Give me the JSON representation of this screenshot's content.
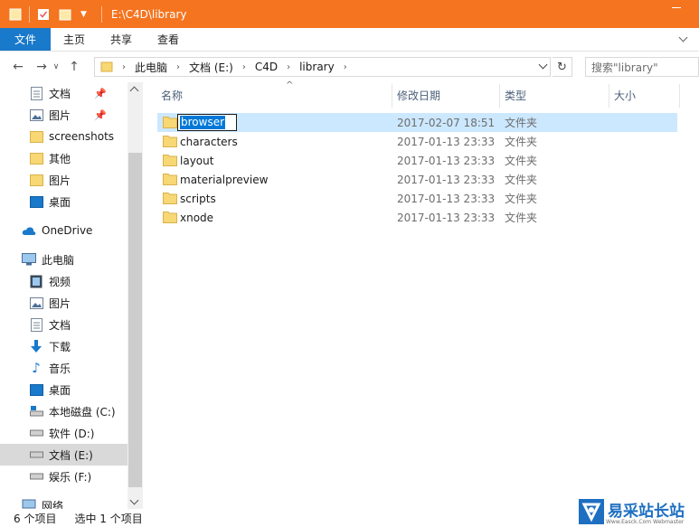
{
  "window": {
    "title": "E:\\C4D\\library"
  },
  "ribbon": {
    "tabs": [
      "文件",
      "主页",
      "共享",
      "查看"
    ]
  },
  "address": {
    "crumbs": [
      "此电脑",
      "文档 (E:)",
      "C4D",
      "library"
    ],
    "search_placeholder": "搜索\"library\""
  },
  "sidebar": {
    "items": [
      {
        "label": "文档",
        "icon": "document-icon",
        "pinned": true
      },
      {
        "label": "图片",
        "icon": "pictures-icon",
        "pinned": true
      },
      {
        "label": "screenshots",
        "icon": "folder-icon"
      },
      {
        "label": "其他",
        "icon": "folder-icon"
      },
      {
        "label": "图片",
        "icon": "folder-icon"
      },
      {
        "label": "桌面",
        "icon": "desktop-icon"
      },
      {
        "label": "OneDrive",
        "icon": "cloud-icon"
      },
      {
        "label": "此电脑",
        "icon": "computer-icon"
      },
      {
        "label": "视频",
        "icon": "video-icon"
      },
      {
        "label": "图片",
        "icon": "pictures-icon"
      },
      {
        "label": "文档",
        "icon": "document-icon"
      },
      {
        "label": "下载",
        "icon": "download-icon"
      },
      {
        "label": "音乐",
        "icon": "music-icon"
      },
      {
        "label": "桌面",
        "icon": "desktop-icon"
      },
      {
        "label": "本地磁盘 (C:)",
        "icon": "drive-icon"
      },
      {
        "label": "软件 (D:)",
        "icon": "drive-icon"
      },
      {
        "label": "文档 (E:)",
        "icon": "drive-icon",
        "selected": true
      },
      {
        "label": "娱乐 (F:)",
        "icon": "drive-icon"
      },
      {
        "label": "网络",
        "icon": "network-icon"
      }
    ]
  },
  "columns": {
    "name": "名称",
    "date": "修改日期",
    "type": "类型",
    "size": "大小"
  },
  "files": [
    {
      "name": "browser",
      "date": "2017-02-07 18:51",
      "type": "文件夹",
      "renaming": true
    },
    {
      "name": "characters",
      "date": "2017-01-13 23:33",
      "type": "文件夹"
    },
    {
      "name": "layout",
      "date": "2017-01-13 23:33",
      "type": "文件夹"
    },
    {
      "name": "materialpreview",
      "date": "2017-01-13 23:33",
      "type": "文件夹"
    },
    {
      "name": "scripts",
      "date": "2017-01-13 23:33",
      "type": "文件夹"
    },
    {
      "name": "xnode",
      "date": "2017-01-13 23:33",
      "type": "文件夹"
    }
  ],
  "status": {
    "count": "6 个项目",
    "selected": "选中 1 个项目"
  },
  "watermark": {
    "text": "易采站长站",
    "sub": "Www.Easck.Com Webmaster"
  },
  "colors": {
    "titlebar": "#f5741f",
    "file_tab": "#1979ca",
    "selection": "#cce8ff",
    "folder": "#f8d775"
  }
}
